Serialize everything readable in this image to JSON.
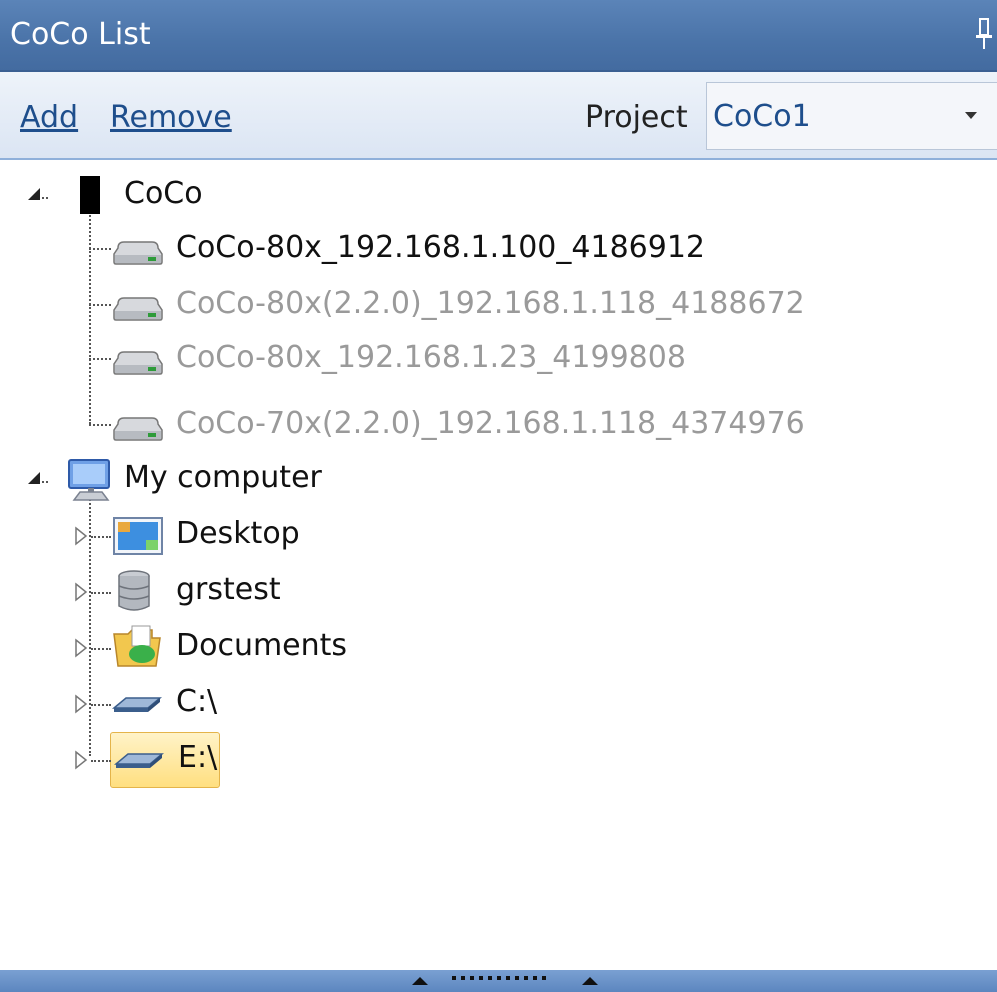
{
  "window": {
    "title": "CoCo List"
  },
  "toolbar": {
    "add_label": "Add",
    "remove_label": "Remove",
    "project_label": "Project",
    "project_value": "CoCo1"
  },
  "tree": {
    "coco_group": {
      "label": "CoCo",
      "children": [
        {
          "label": "CoCo-80x_192.168.1.100_4186912",
          "state": "online"
        },
        {
          "label": "CoCo-80x(2.2.0)_192.168.1.118_4188672",
          "state": "offline"
        },
        {
          "label": "CoCo-80x_192.168.1.23_4199808",
          "state": "offline"
        },
        {
          "label": "CoCo-70x(2.2.0)_192.168.1.118_4374976",
          "state": "offline"
        }
      ]
    },
    "computer_group": {
      "label": "My computer",
      "children": [
        {
          "label": "Desktop",
          "icon": "desktop-icon"
        },
        {
          "label": "grstest",
          "icon": "database-icon"
        },
        {
          "label": "Documents",
          "icon": "documents-folder-icon"
        },
        {
          "label": "C:\\",
          "icon": "drive-icon"
        },
        {
          "label": "E:\\",
          "icon": "drive-icon",
          "selected": true
        }
      ]
    }
  },
  "colors": {
    "titlebar": "#4a73a8",
    "link": "#1e4e8c",
    "dim_text": "#9a9a9a",
    "selection": "#ffdf80"
  }
}
